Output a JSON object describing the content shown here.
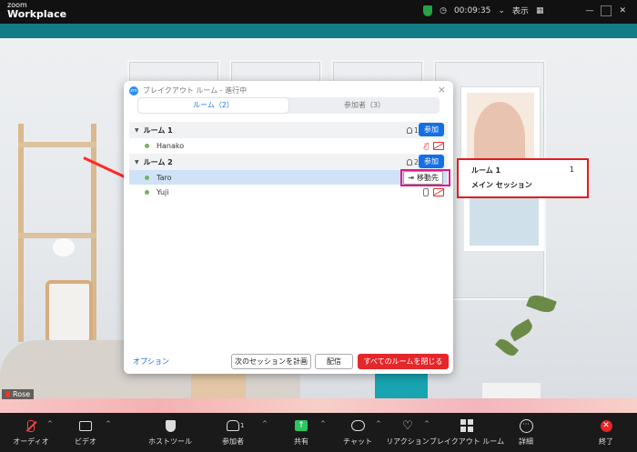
{
  "app": {
    "brand_line1": "zoom",
    "brand_line2": "Workplace"
  },
  "titlebar": {
    "timer": "00:09:35",
    "view_label": "表示"
  },
  "video": {
    "participant_name": "Rose"
  },
  "dialog": {
    "title": "ブレイクアウト ルーム - 進行中",
    "close": "×",
    "tabs": [
      {
        "label": "ルーム（2）",
        "active": true
      },
      {
        "label": "参加者（3）",
        "active": false
      }
    ],
    "rooms": [
      {
        "name": "ルーム 1",
        "count": "1",
        "join_label": "参加",
        "participants": [
          {
            "name": "Hanako",
            "mic": "off",
            "video": "off"
          }
        ]
      },
      {
        "name": "ルーム 2",
        "count": "2",
        "join_label": "参加",
        "participants": [
          {
            "name": "Taro",
            "selected": true,
            "move_label": "移動先"
          },
          {
            "name": "Yuji",
            "mic": "on",
            "video": "off"
          }
        ]
      }
    ],
    "footer": {
      "options_link": "オプション",
      "schedule_label": "次のセッションを計画",
      "broadcast_label": "配信",
      "close_all_label": "すべてのルームを閉じる"
    }
  },
  "move_menu": {
    "items": [
      {
        "label": "ルーム 1",
        "count": "1"
      },
      {
        "label": "メイン セッション"
      }
    ]
  },
  "toolbar": {
    "items": [
      {
        "label": "オーディオ",
        "icon": "mic-muted-icon"
      },
      {
        "label": "ビデオ",
        "icon": "video-icon"
      },
      {
        "label": "ホストツール",
        "icon": "shield-icon"
      },
      {
        "label": "参加者",
        "icon": "people-icon",
        "count": "1"
      },
      {
        "label": "共有",
        "icon": "share-icon"
      },
      {
        "label": "チャット",
        "icon": "chat-icon"
      },
      {
        "label": "リアクション",
        "icon": "reaction-icon"
      },
      {
        "label": "ブレイクアウト ルーム",
        "icon": "breakout-rooms-icon"
      },
      {
        "label": "詳細",
        "icon": "more-icon"
      },
      {
        "label": "終了",
        "icon": "end-icon"
      }
    ]
  },
  "colors": {
    "accent": "#1570e5",
    "danger": "#e5262a",
    "highlight_pink": "#e0188a",
    "share_green": "#2ac561"
  }
}
